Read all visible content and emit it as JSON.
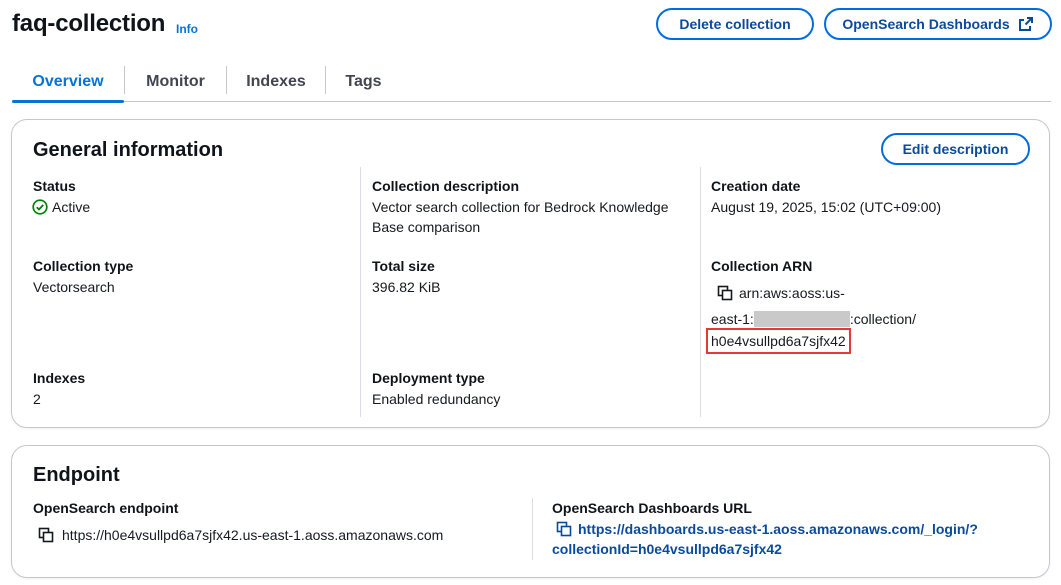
{
  "header": {
    "title": "faq-collection",
    "info_label": "Info",
    "delete_label": "Delete collection",
    "dashboards_label": "OpenSearch Dashboards"
  },
  "tabs": [
    {
      "label": "Overview",
      "active": true
    },
    {
      "label": "Monitor",
      "active": false
    },
    {
      "label": "Indexes",
      "active": false
    },
    {
      "label": "Tags",
      "active": false
    }
  ],
  "general": {
    "title": "General information",
    "edit_label": "Edit description",
    "status_label": "Status",
    "status_value": "Active",
    "collection_type_label": "Collection type",
    "collection_type_value": "Vectorsearch",
    "indexes_label": "Indexes",
    "indexes_value": "2",
    "description_label": "Collection description",
    "description_value": "Vector search collection for Bedrock Knowledge Base comparison",
    "total_size_label": "Total size",
    "total_size_value": "396.82 KiB",
    "deployment_label": "Deployment type",
    "deployment_value": "Enabled redundancy",
    "creation_label": "Creation date",
    "creation_value": "August 19, 2025, 15:02 (UTC+09:00)",
    "arn_label": "Collection ARN",
    "arn_part1": "arn:aws:aoss:us-",
    "arn_part2_prefix": "east-1:",
    "arn_part2_suffix": ":collection/",
    "arn_id": "h0e4vsullpd6a7sjfx42"
  },
  "endpoint": {
    "title": "Endpoint",
    "opensearch_label": "OpenSearch endpoint",
    "opensearch_value": "https://h0e4vsullpd6a7sjfx42.us-east-1.aoss.amazonaws.com",
    "dashboards_label": "OpenSearch Dashboards URL",
    "dashboards_url_line1": "https://dashboards.us-east-1.aoss.amazonaws.com/_login/?",
    "dashboards_url_line2": "collectionId=h0e4vsullpd6a7sjfx42"
  },
  "colors": {
    "accent": "#0972d3",
    "success": "#037f0c",
    "highlight": "#e53935"
  },
  "icons": [
    "external-link-icon",
    "status-success-icon",
    "copy-icon"
  ]
}
